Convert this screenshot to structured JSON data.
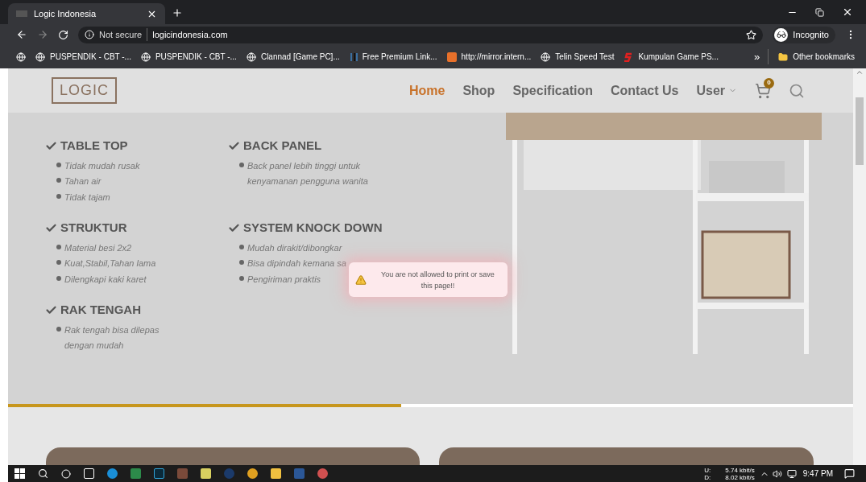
{
  "browser": {
    "tabs": [
      {
        "title": "Logic Indonesia",
        "selected": true
      }
    ],
    "address": {
      "security": "Not secure",
      "url": "logicindonesia.com"
    },
    "profile": "Incognito",
    "bookmarks": [
      {
        "label": "PUSPENDIK - CBT -...",
        "kind": "globe"
      },
      {
        "label": "PUSPENDIK - CBT -...",
        "kind": "globe"
      },
      {
        "label": "Clannad [Game PC]...",
        "kind": "globe"
      },
      {
        "label": "Free Premium Link...",
        "kind": "bars"
      },
      {
        "label": "http://mirror.intern...",
        "kind": "square"
      },
      {
        "label": "Telin Speed Test",
        "kind": "globe"
      },
      {
        "label": "Kumpulan Game PS...",
        "kind": "letter"
      }
    ],
    "overflow": "»",
    "other_bookmarks": "Other bookmarks"
  },
  "site": {
    "logo": "LOGIC",
    "nav": [
      {
        "label": "Home",
        "selected": true
      },
      {
        "label": "Shop",
        "selected": false
      },
      {
        "label": "Specification",
        "selected": false
      },
      {
        "label": "Contact Us",
        "selected": false
      },
      {
        "label": "User",
        "selected": false,
        "dropdown": true
      }
    ],
    "cart_count": "0",
    "feature_columns": [
      [
        {
          "title": "TABLE TOP",
          "items": [
            "Tidak mudah rusak",
            "Tahan air",
            "Tidak tajam"
          ]
        },
        {
          "title": "STRUKTUR",
          "items": [
            "Material besi 2x2",
            "Kuat,Stabil,Tahan lama",
            "Dilengkapi kaki karet"
          ]
        },
        {
          "title": "RAK TENGAH",
          "items": [
            "Rak tengah bisa dilepas dengan mudah"
          ]
        }
      ],
      [
        {
          "title": "BACK PANEL",
          "items": [
            "Back panel lebih tinggi untuk kenyamanan pengguna wanita"
          ]
        },
        {
          "title": "SYSTEM KNOCK DOWN",
          "items": [
            "Mudah dirakit/dibongkar",
            "Bisa dipindah kemana sa",
            "Pengiriman praktis"
          ]
        }
      ]
    ],
    "toast": "You are not allowed to print or save this page!!"
  },
  "taskbar": {
    "net_up_label": "U:",
    "net_up": "5.74 kbit/s",
    "net_down_label": "D:",
    "net_down": "8.02 kbit/s",
    "time": "9:47 PM"
  }
}
